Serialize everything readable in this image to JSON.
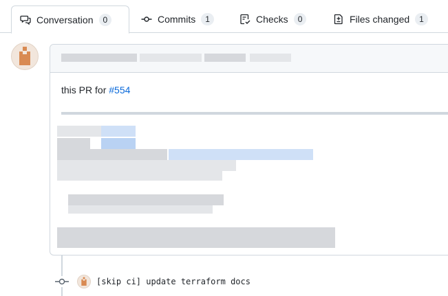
{
  "tabs": [
    {
      "label": "Conversation",
      "count": "0",
      "icon": "conversation-icon"
    },
    {
      "label": "Commits",
      "count": "1",
      "icon": "commit-icon"
    },
    {
      "label": "Checks",
      "count": "0",
      "icon": "checks-icon"
    },
    {
      "label": "Files changed",
      "count": "1",
      "icon": "file-diff-icon"
    }
  ],
  "comment": {
    "body_prefix": "this PR for ",
    "issue_link": "#554"
  },
  "commit": {
    "message": "[skip ci] update terraform docs"
  },
  "colors": {
    "link": "#0969da",
    "avatar": "#d98a52",
    "border": "#d0d7de"
  }
}
